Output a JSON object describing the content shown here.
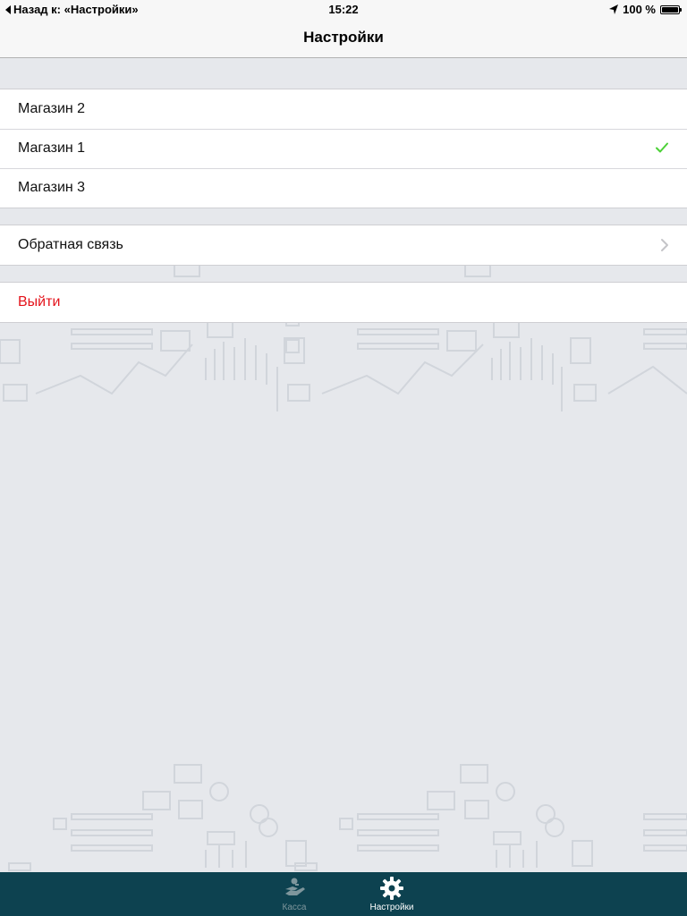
{
  "status_bar": {
    "back_label": "Назад к: «Настройки»",
    "time": "15:22",
    "battery": "100 %"
  },
  "nav": {
    "title": "Настройки"
  },
  "stores": {
    "items": [
      {
        "label": "Магазин 2",
        "selected": false
      },
      {
        "label": "Магазин 1",
        "selected": true
      },
      {
        "label": "Магазин 3",
        "selected": false
      }
    ]
  },
  "feedback": {
    "label": "Обратная связь"
  },
  "logout": {
    "label": "Выйти"
  },
  "tab_bar": {
    "tabs": [
      {
        "label": "Касса",
        "icon": "cash-register-icon",
        "active": false
      },
      {
        "label": "Настройки",
        "icon": "gear-icon",
        "active": true
      }
    ]
  },
  "colors": {
    "accent_check": "#4cd137",
    "logout_red": "#e4131b",
    "tab_bar_bg": "#0d4250"
  }
}
